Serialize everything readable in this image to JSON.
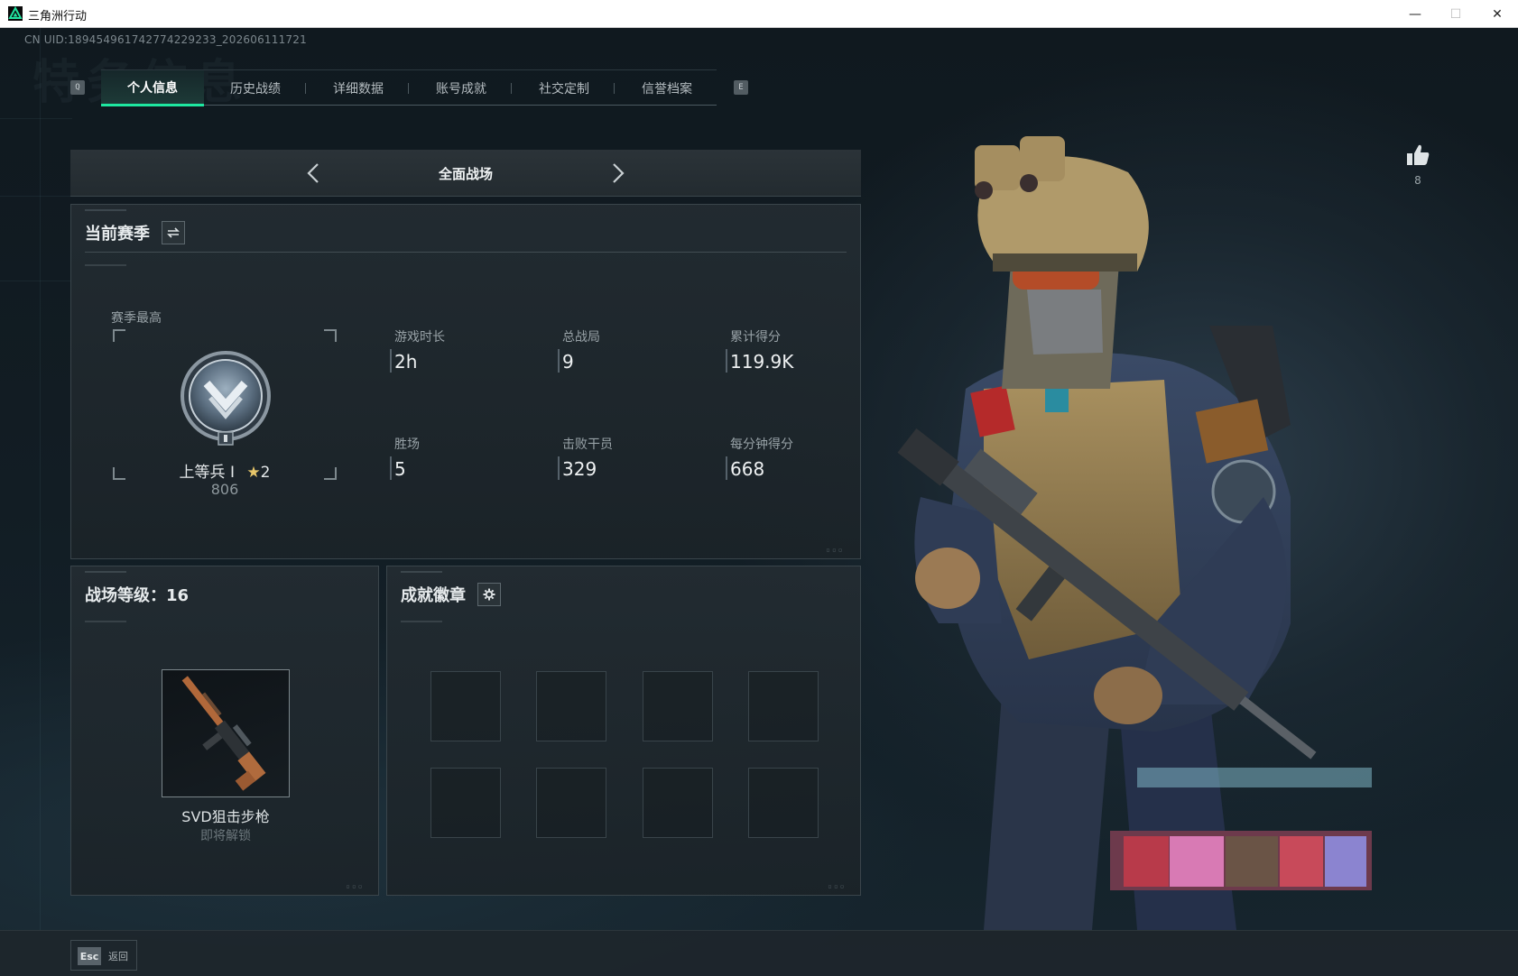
{
  "window": {
    "title": "三角洲行动",
    "min_glyph": "—",
    "max_glyph": "☐",
    "close_glyph": "✕"
  },
  "uid_text": "CN UID:189454961742774229233_202606111721",
  "watermark": "特务信息",
  "tabs": {
    "prev_key": "Q",
    "next_key": "E",
    "items": [
      {
        "label": "个人信息",
        "active": true
      },
      {
        "label": "历史战绩",
        "active": false
      },
      {
        "label": "详细数据",
        "active": false
      },
      {
        "label": "账号成就",
        "active": false
      },
      {
        "label": "社交定制",
        "active": false
      },
      {
        "label": "信誉档案",
        "active": false
      }
    ]
  },
  "mode": {
    "label": "全面战场"
  },
  "season_panel": {
    "title": "当前赛季",
    "switch_icon": "swap-icon",
    "season_best_label": "赛季最高",
    "rank_name": "上等兵 I",
    "rank_stars": "2",
    "rank_score": "806",
    "stats": [
      {
        "label": "游戏时长",
        "value": "2h"
      },
      {
        "label": "总战局",
        "value": "9"
      },
      {
        "label": "累计得分",
        "value": "119.9K"
      },
      {
        "label": "胜场",
        "value": "5"
      },
      {
        "label": "击败干员",
        "value": "329"
      },
      {
        "label": "每分钟得分",
        "value": "668"
      }
    ]
  },
  "level_panel": {
    "title": "战场等级：16",
    "weapon_name": "SVD狙击步枪",
    "weapon_status": "即将解锁"
  },
  "badge_panel": {
    "title": "成就徽章",
    "settings_icon": "gear-icon",
    "slots": 8
  },
  "like": {
    "icon": "thumbs-up-icon",
    "count": "8"
  },
  "bottom": {
    "esc_key": "Esc",
    "back_label": "返回"
  },
  "colors": {
    "accent": "#1ee8a0",
    "background": "#0d1419",
    "panel": "#232c32"
  }
}
